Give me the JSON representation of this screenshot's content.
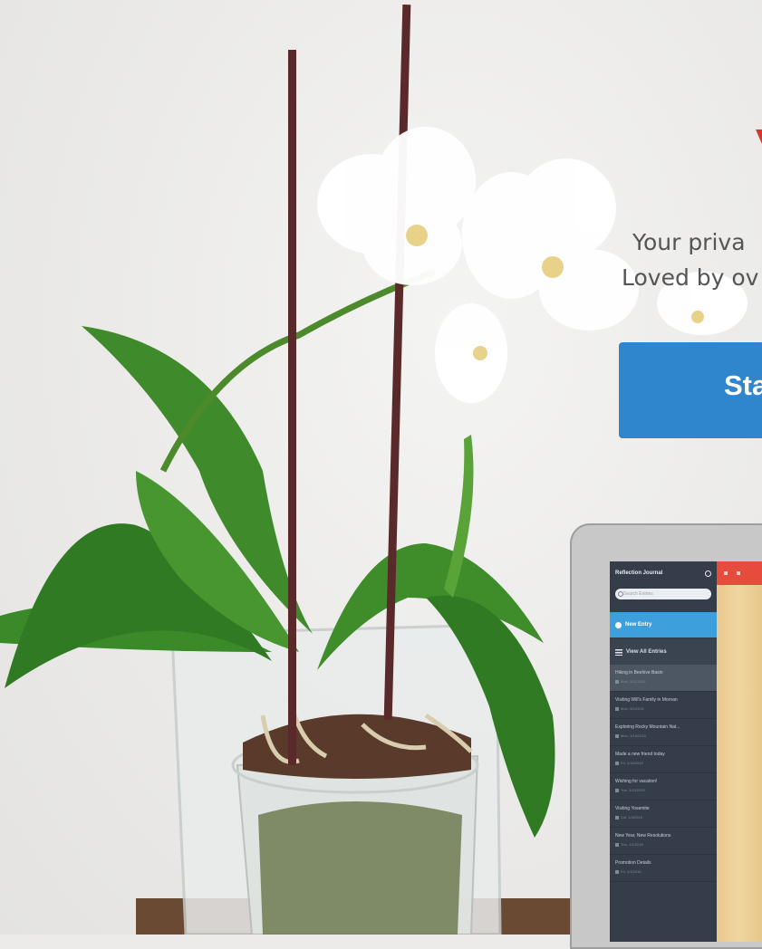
{
  "hero": {
    "tagline_line1": "Your priva",
    "tagline_line2": "Loved by ov",
    "cta_label": "Sta",
    "photo_subject": "white orchid in glass pot"
  },
  "colors": {
    "cta_blue": "#2f86cc",
    "accent_red": "#d9352b",
    "sidebar_dark": "#343d49",
    "toolbar_red": "#e64b3c",
    "new_entry_blue": "#3d9fdc"
  },
  "app_preview": {
    "app_title": "Reflection Journal",
    "search_placeholder": "Search Entries",
    "new_entry_label": "New Entry",
    "view_all_label": "View All Entries",
    "entries": [
      {
        "title": "Hiking in Beehive Basin",
        "date": "Mon, 3/11/2015"
      },
      {
        "title": "Visiting Will's Family in Mornan",
        "date": "Mon, 3/2/2015"
      },
      {
        "title": "Exploring Rocky Mountain Nat...",
        "date": "Mon, 1/19/2015"
      },
      {
        "title": "Made a new friend today",
        "date": "Fri, 1/16/2015"
      },
      {
        "title": "Wishing for vacation!",
        "date": "Tue, 1/13/2015"
      },
      {
        "title": "Visiting Yosemite",
        "date": "Sat, 1/3/2015"
      },
      {
        "title": "New Year, New Resolutions",
        "date": "Thu, 1/1/2015"
      },
      {
        "title": "Promotion Details",
        "date": "Fri, 1/1/2015"
      }
    ]
  }
}
